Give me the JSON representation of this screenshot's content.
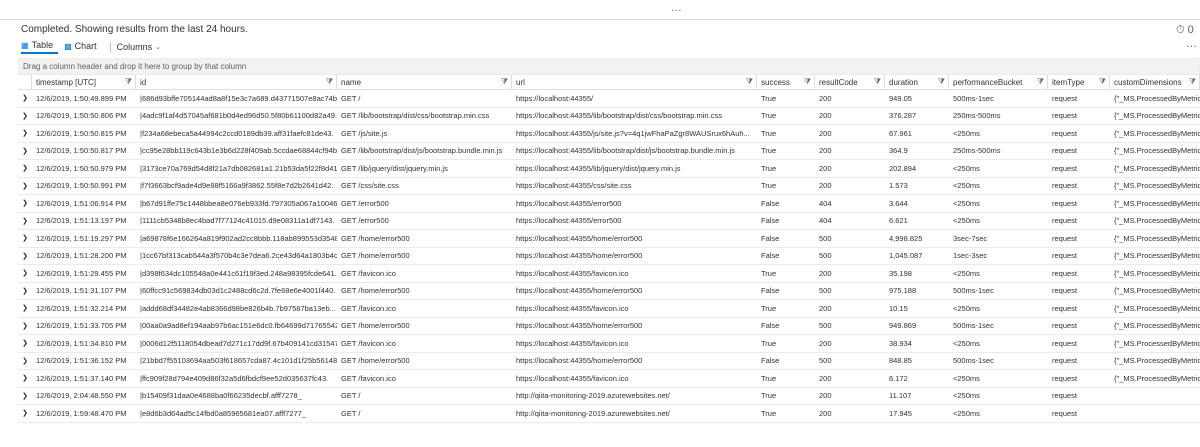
{
  "toolbar": {
    "handle": "...",
    "status": "Completed. Showing results from the last 24 hours.",
    "timer": "⏱ 0",
    "tab_table": "Table",
    "tab_chart": "Chart",
    "columns_label": "Columns",
    "more": "…"
  },
  "group_hint": "Drag a column header and drop it here to group by that column",
  "columns": [
    "timestamp [UTC]",
    "id",
    "name",
    "url",
    "success",
    "resultCode",
    "duration",
    "performanceBucket",
    "itemType",
    "customDimensions"
  ],
  "rows": [
    {
      "timestamp": "12/6/2019, 1:50:49.899 PM",
      "id": "|686d93bffe705144ad8a8f15e3c7a689.d43771507e8ac74b.",
      "name": "GET /",
      "url": "https://localhost:44355/",
      "success": "True",
      "resultCode": "200",
      "duration": "949.05",
      "performanceBucket": "500ms-1sec",
      "itemType": "request",
      "customDimensions": "{\"_MS.ProcessedByMetric"
    },
    {
      "timestamp": "12/6/2019, 1:50:50.806 PM",
      "id": "|4adc9f1af4d57045af681b0d4ed96d50.5f80b61100d82a49.",
      "name": "GET /lib/bootstrap/dist/css/bootstrap.min.css",
      "url": "https://localhost:44355/lib/bootstrap/dist/css/bootstrap.min.css",
      "success": "True",
      "resultCode": "200",
      "duration": "376.287",
      "performanceBucket": "250ms-500ms",
      "itemType": "request",
      "customDimensions": "{\"_MS.ProcessedByMetric"
    },
    {
      "timestamp": "12/6/2019, 1:50:50.815 PM",
      "id": "|f234a68ebeca5a44994c2ccd0189db39.aff31faefc81de43.",
      "name": "GET /js/site.js",
      "url": "https://localhost:44355/js/site.js?v=4q1jwFhaPaZgr8WAUSrux6hAuh...",
      "success": "True",
      "resultCode": "200",
      "duration": "67.961",
      "performanceBucket": "<250ms",
      "itemType": "request",
      "customDimensions": "{\"_MS.ProcessedByMetric"
    },
    {
      "timestamp": "12/6/2019, 1:50:50.817 PM",
      "id": "|cc95e28bb119c643b1e3b6d228f409ab.5ccdae68844cf94b.",
      "name": "GET /lib/bootstrap/dist/js/bootstrap.bundle.min.js",
      "url": "https://localhost:44355/lib/bootstrap/dist/js/bootstrap.bundle.min.js",
      "success": "True",
      "resultCode": "200",
      "duration": "364.9",
      "performanceBucket": "250ms-500ms",
      "itemType": "request",
      "customDimensions": "{\"_MS.ProcessedByMetric"
    },
    {
      "timestamp": "12/6/2019, 1:50:50.979 PM",
      "id": "|3173ce70a769d54d8f21a7db082681a1.21b53da5f22f8d41.",
      "name": "GET /lib/jquery/dist/jquery.min.js",
      "url": "https://localhost:44355/lib/jquery/dist/jquery.min.js",
      "success": "True",
      "resultCode": "200",
      "duration": "202.894",
      "performanceBucket": "<250ms",
      "itemType": "request",
      "customDimensions": "{\"_MS.ProcessedByMetric"
    },
    {
      "timestamp": "12/6/2019, 1:50:50.991 PM",
      "id": "|f7f3663bcf9ade4d9e88f5166a9f3862.55f8e7d2b2641d42.",
      "name": "GET /css/site.css",
      "url": "https://localhost:44355/css/site.css",
      "success": "True",
      "resultCode": "200",
      "duration": "1.573",
      "performanceBucket": "<250ms",
      "itemType": "request",
      "customDimensions": "{\"_MS.ProcessedByMetric"
    },
    {
      "timestamp": "12/6/2019, 1:51:06.914 PM",
      "id": "|b67d91ffe75c1448bbea8e076eb933fd.797305a067a10046.",
      "name": "GET /error500",
      "url": "https://localhost:44355/error500",
      "success": "False",
      "resultCode": "404",
      "duration": "3.644",
      "performanceBucket": "<250ms",
      "itemType": "request",
      "customDimensions": "{\"_MS.ProcessedByMetric"
    },
    {
      "timestamp": "12/6/2019, 1:51:13.197 PM",
      "id": "|1111cb5348b8ec4bad7f77124c41015.d9e08311a1df7143.",
      "name": "GET /error500",
      "url": "https://localhost:44355/error500",
      "success": "False",
      "resultCode": "404",
      "duration": "6.621",
      "performanceBucket": "<250ms",
      "itemType": "request",
      "customDimensions": "{\"_MS.ProcessedByMetric"
    },
    {
      "timestamp": "12/6/2019, 1:51:19.297 PM",
      "id": "|a69878f6e166264a819f902ad2cc8bbb.118ab899553d3548.",
      "name": "GET /home/error500",
      "url": "https://localhost:44355/home/error500",
      "success": "False",
      "resultCode": "500",
      "duration": "4,998.825",
      "performanceBucket": "3sec-7sec",
      "itemType": "request",
      "customDimensions": "{\"_MS.ProcessedByMetric"
    },
    {
      "timestamp": "12/6/2019, 1:51:28.200 PM",
      "id": "|1cc67bf313cab544a3f570b4c3e7dea6.2ce43d64a1803b4c.",
      "name": "GET /home/error500",
      "url": "https://localhost:44355/home/error500",
      "success": "False",
      "resultCode": "500",
      "duration": "1,045.087",
      "performanceBucket": "1sec-3sec",
      "itemType": "request",
      "customDimensions": "{\"_MS.ProcessedByMetric"
    },
    {
      "timestamp": "12/6/2019, 1:51:29.455 PM",
      "id": "|d398f634dc105548a0e441c61f19f3ed.248a98395fcde641.",
      "name": "GET /favicon.ico",
      "url": "https://localhost:44355/favicon.ico",
      "success": "True",
      "resultCode": "200",
      "duration": "35.198",
      "performanceBucket": "<250ms",
      "itemType": "request",
      "customDimensions": "{\"_MS.ProcessedByMetric"
    },
    {
      "timestamp": "12/6/2019, 1:51:31.107 PM",
      "id": "|60ffcc91c569834db03d1c2488cd6c2d.7fe68e6e4001f440.",
      "name": "GET /home/error500",
      "url": "https://localhost:44355/home/error500",
      "success": "False",
      "resultCode": "500",
      "duration": "975.188",
      "performanceBucket": "500ms-1sec",
      "itemType": "request",
      "customDimensions": "{\"_MS.ProcessedByMetric"
    },
    {
      "timestamp": "12/6/2019, 1:51:32.214 PM",
      "id": "|addd68df34482e4ab8366d98be826b4b.7b97587ba13eb...",
      "name": "GET /favicon.ico",
      "url": "https://localhost:44355/favicon.ico",
      "success": "True",
      "resultCode": "200",
      "duration": "10.15",
      "performanceBucket": "<250ms",
      "itemType": "request",
      "customDimensions": "{\"_MS.ProcessedByMetric"
    },
    {
      "timestamp": "12/6/2019, 1:51:33.705 PM",
      "id": "|00aa0a9ad8ef194aab97b6ac151e6dc0.fb64699d71765542.",
      "name": "GET /home/error500",
      "url": "https://localhost:44355/home/error500",
      "success": "False",
      "resultCode": "500",
      "duration": "949.869",
      "performanceBucket": "500ms-1sec",
      "itemType": "request",
      "customDimensions": "{\"_MS.ProcessedByMetric"
    },
    {
      "timestamp": "12/6/2019, 1:51:34.810 PM",
      "id": "|0006d12f5118054dbead7d271c17dd9f.67b409141cd31547.",
      "name": "GET /favicon.ico",
      "url": "https://localhost:44355/favicon.ico",
      "success": "True",
      "resultCode": "200",
      "duration": "38.934",
      "performanceBucket": "<250ms",
      "itemType": "request",
      "customDimensions": "{\"_MS.ProcessedByMetric"
    },
    {
      "timestamp": "12/6/2019, 1:51:36.152 PM",
      "id": "|21bbd7f55103694aa503f618657cda87.4c101d1f25b56148.",
      "name": "GET /home/error500",
      "url": "https://localhost:44355/home/error500",
      "success": "False",
      "resultCode": "500",
      "duration": "848.85",
      "performanceBucket": "500ms-1sec",
      "itemType": "request",
      "customDimensions": "{\"_MS.ProcessedByMetric"
    },
    {
      "timestamp": "12/6/2019, 1:51:37.140 PM",
      "id": "|ffc909f28d794e409d86f32a5d6fbdcf9ee52d035637fc43.",
      "name": "GET /favicon.ico",
      "url": "https://localhost:44355/favicon.ico",
      "success": "True",
      "resultCode": "200",
      "duration": "6.172",
      "performanceBucket": "<250ms",
      "itemType": "request",
      "customDimensions": "{\"_MS.ProcessedByMetric"
    },
    {
      "timestamp": "12/6/2019, 2:04:48.550 PM",
      "id": "|b15409f31daa0e4688ba0f66235decbf.afff7278_",
      "name": "GET /",
      "url": "http://qiita-monitoring-2019.azurewebsites.net/",
      "success": "True",
      "resultCode": "200",
      "duration": "11.107",
      "performanceBucket": "<250ms",
      "itemType": "request",
      "customDimensions": ""
    },
    {
      "timestamp": "12/6/2019, 1:59:48.470 PM",
      "id": "|e8d6b3d64ad5c14fbd0a85965681ea07.afff7277_",
      "name": "GET /",
      "url": "http://qiita-monitoring-2019.azurewebsites.net/",
      "success": "True",
      "resultCode": "200",
      "duration": "17.945",
      "performanceBucket": "<250ms",
      "itemType": "request",
      "customDimensions": ""
    }
  ],
  "icons": {
    "expand": "chevron-right-icon",
    "filter": "filter-icon",
    "table": "table-icon",
    "chart": "bar-chart-icon",
    "timer": "stopwatch-icon"
  },
  "colors": {
    "accent": "#0078d4",
    "header_border": "#e1dfdd",
    "row_border": "#ecebea",
    "group_bar": "#f3f2f1"
  }
}
